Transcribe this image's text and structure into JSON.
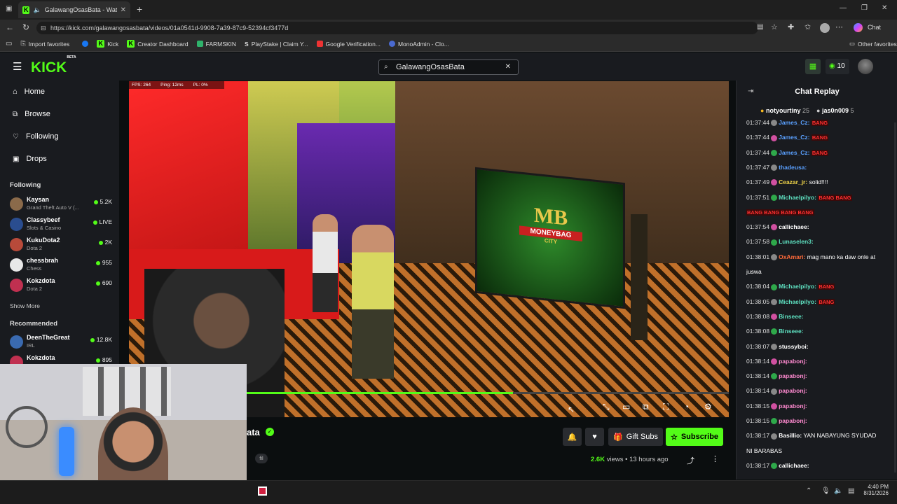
{
  "browser": {
    "tab_title": "GalawangOsasBata - Watch th",
    "url": "https://kick.com/galawangosasbata/videos/01a0541d-9908-7a39-87c9-52394cf3477d",
    "favorites": [
      "Import favorites",
      "Kick",
      "Creator Dashboard",
      "FARMSKIN",
      "PlayStake | Claim Y...",
      "Google Verification...",
      "MonoAdmin - Clo..."
    ],
    "other_favorites": "Other favorites",
    "chat_label": "Chat"
  },
  "header": {
    "logo": "KICK",
    "logo_sup": "BETA",
    "search_value": "GalawangOsasBata",
    "points": "10"
  },
  "sidebar": {
    "nav": [
      "Home",
      "Browse",
      "Following",
      "Drops"
    ],
    "following_title": "Following",
    "following": [
      {
        "name": "Kaysan",
        "game": "Grand Theft Auto V (...",
        "viewers": "5.2K",
        "color": "#8a6a4a"
      },
      {
        "name": "Classybeef",
        "game": "Slots & Casino",
        "viewers": "LIVE",
        "color": "#2a4d8f"
      },
      {
        "name": "KukuDota2",
        "game": "Dota 2",
        "viewers": "2K",
        "color": "#b84a3a"
      },
      {
        "name": "chessbrah",
        "game": "Chess",
        "viewers": "955",
        "color": "#e8e8e8"
      },
      {
        "name": "Kokzdota",
        "game": "Dota 2",
        "viewers": "690",
        "color": "#c03050"
      }
    ],
    "show_more": "Show More",
    "recommended_title": "Recommended",
    "recommended": [
      {
        "name": "DeenTheGreat",
        "game": "IRL",
        "viewers": "12.8K",
        "color": "#3a6ab0"
      },
      {
        "name": "Kokzdota",
        "game": "",
        "viewers": "895",
        "color": "#c03050"
      }
    ]
  },
  "video": {
    "fps": "FPS: 264",
    "ping": "Ping: 12ms",
    "pl": "PL: 0%",
    "sign_line1": "MB",
    "sign_line2": "MONEYBAG",
    "sign_line3": "CITY"
  },
  "channel": {
    "name_partial": "ata",
    "tag": "fil",
    "views_count": "2.6K",
    "views_label": "views",
    "age": "13 hours ago",
    "gift_label": "Gift Subs",
    "subscribe_label": "Subscribe"
  },
  "chat": {
    "title": "Chat Replay",
    "pinned": [
      {
        "name": "notyourtiny",
        "count": "25"
      },
      {
        "name": "jas0n009",
        "count": "5"
      }
    ],
    "messages": [
      {
        "time": "01:37:44",
        "user": "James_Cz:",
        "text": "",
        "color": "#5aa0ff",
        "emote": "BANG"
      },
      {
        "time": "01:37:44",
        "user": "James_Cz:",
        "text": "",
        "color": "#5aa0ff",
        "emote": "BANG"
      },
      {
        "time": "01:37:44",
        "user": "James_Cz:",
        "text": "",
        "color": "#5aa0ff",
        "emote": "BANG"
      },
      {
        "time": "01:37:47",
        "user": "thadeusa:",
        "text": "",
        "color": "#5aa0ff",
        "emote": ""
      },
      {
        "time": "01:37:49",
        "user": "Ceazar_jr:",
        "text": "solid!!!!",
        "color": "#f5d94a",
        "emote": ""
      },
      {
        "time": "01:37:51",
        "user": "Michaelpilyo:",
        "text": "",
        "color": "#5ee0c0",
        "emote": "BANG BANG"
      },
      {
        "time": "",
        "user": "",
        "text": "",
        "color": "#e03030",
        "emote": "BANG BANG BANG BANG"
      },
      {
        "time": "01:37:54",
        "user": "callichaee:",
        "text": "",
        "color": "#ffffff",
        "emote": ""
      },
      {
        "time": "01:37:58",
        "user": "Lunaselen3:",
        "text": "",
        "color": "#5ee0c0",
        "emote": ""
      },
      {
        "time": "01:38:01",
        "user": "OxAmari:",
        "text": "mag mano ka daw onle at",
        "color": "#ff6a3a",
        "emote": ""
      },
      {
        "time": "",
        "user": "",
        "text": "juswa",
        "color": "#ffffff",
        "emote": ""
      },
      {
        "time": "01:38:04",
        "user": "Michaelpilyo:",
        "text": "",
        "color": "#5ee0c0",
        "emote": "BANG"
      },
      {
        "time": "01:38:05",
        "user": "Michaelpilyo:",
        "text": "",
        "color": "#5ee0c0",
        "emote": "BANG"
      },
      {
        "time": "01:38:08",
        "user": "Binseee:",
        "text": "",
        "color": "#5ee0c0",
        "emote": ""
      },
      {
        "time": "01:38:08",
        "user": "Binseee:",
        "text": "",
        "color": "#5ee0c0",
        "emote": ""
      },
      {
        "time": "01:38:07",
        "user": "stussyboi:",
        "text": "",
        "color": "#ffffff",
        "emote": ""
      },
      {
        "time": "01:38:14",
        "user": "papabonj:",
        "text": "",
        "color": "#ff8ad0",
        "emote": ""
      },
      {
        "time": "01:38:14",
        "user": "papabonj:",
        "text": "",
        "color": "#ff8ad0",
        "emote": ""
      },
      {
        "time": "01:38:14",
        "user": "papabonj:",
        "text": "",
        "color": "#ff8ad0",
        "emote": ""
      },
      {
        "time": "01:38:15",
        "user": "papabonj:",
        "text": "",
        "color": "#ff8ad0",
        "emote": ""
      },
      {
        "time": "01:38:15",
        "user": "papabonj:",
        "text": "",
        "color": "#ff8ad0",
        "emote": ""
      },
      {
        "time": "01:38:17",
        "user": "Basillio:",
        "text": "YAN NABAYUNG SYUDAD",
        "color": "#ffffff",
        "emote": ""
      },
      {
        "time": "",
        "user": "",
        "text": "NI BARABAS",
        "color": "#ffffff",
        "emote": ""
      },
      {
        "time": "01:38:17",
        "user": "callichaee:",
        "text": "",
        "color": "#ffffff",
        "emote": ""
      }
    ]
  },
  "taskbar": {
    "time": "4:40 PM",
    "date": "8/31/2026"
  },
  "colors": {
    "accent": "#53fc18",
    "panel": "#191b1f",
    "bg": "#0b0e0f"
  }
}
